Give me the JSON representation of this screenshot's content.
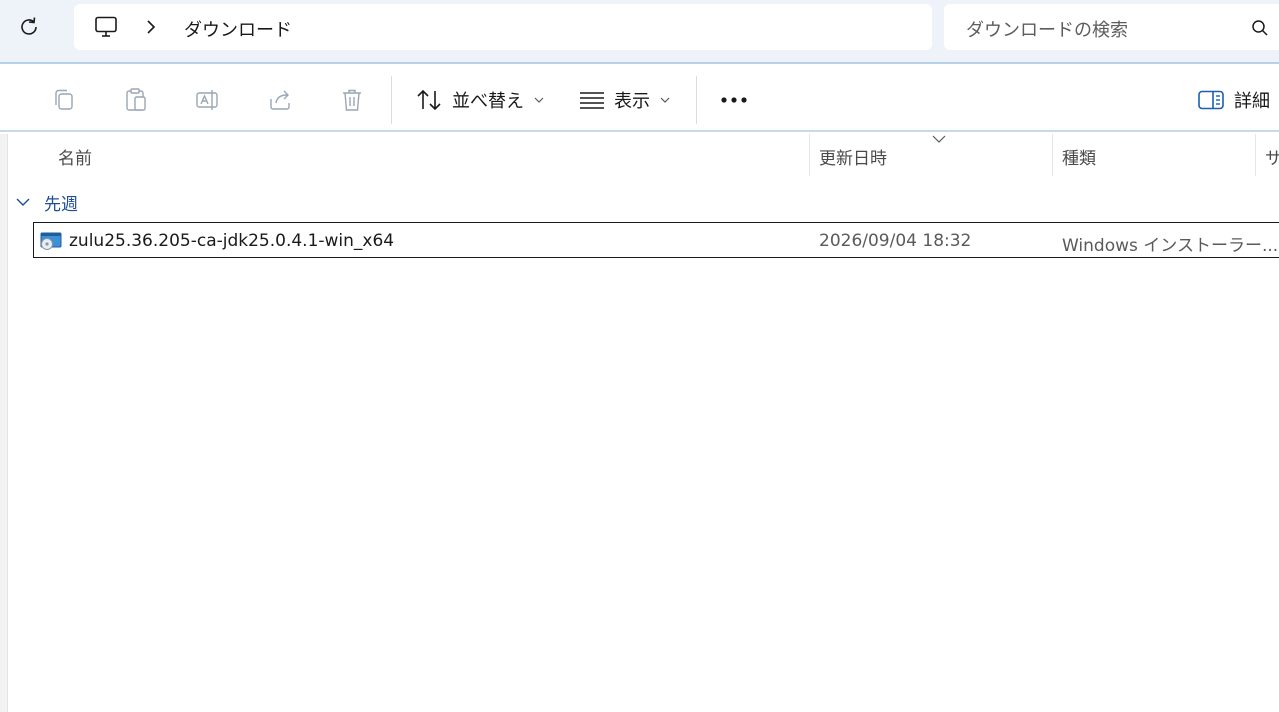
{
  "address_bar": {
    "breadcrumb": "ダウンロード",
    "search_placeholder": "ダウンロードの検索"
  },
  "toolbar": {
    "sort_label": "並べ替え",
    "view_label": "表示",
    "details_label": "詳細"
  },
  "columns": {
    "name": "名前",
    "date_modified": "更新日時",
    "type": "種類",
    "size": "サ"
  },
  "group": {
    "label": "先週"
  },
  "files": [
    {
      "name": "zulu25.36.205-ca-jdk25.0.4.1-win_x64",
      "date": "2026/09/04 18:32",
      "type": "Windows インストーラー..."
    }
  ],
  "icons": [
    "refresh-icon",
    "pc-icon",
    "chevron-right-icon",
    "search-icon",
    "copy-icon",
    "paste-icon",
    "rename-icon",
    "share-icon",
    "delete-icon",
    "sort-icon",
    "view-icon",
    "more-icon",
    "details-pane-icon",
    "installer-icon"
  ]
}
